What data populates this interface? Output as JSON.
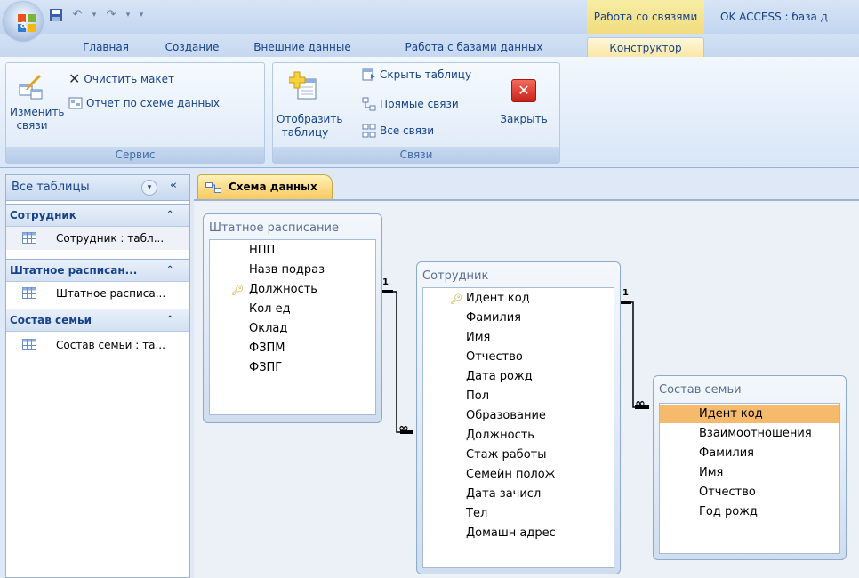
{
  "titlebar": {
    "context_tab": "Работа со связями",
    "app_title": "OK ACCESS : база д"
  },
  "tabs": [
    "Главная",
    "Создание",
    "Внешние данные",
    "Работа с базами данных",
    "Конструктор"
  ],
  "ribbon": {
    "service": {
      "title": "Сервис",
      "edit_relations": "Изменить связи",
      "clear_layout": "Очистить макет",
      "schema_report": "Отчет по схеме данных"
    },
    "relations": {
      "title": "Связи",
      "show_table": "Отобразить таблицу",
      "hide_table": "Скрыть таблицу",
      "direct_relations": "Прямые связи",
      "all_relations": "Все связи",
      "close": "Закрыть"
    }
  },
  "nav": {
    "header": "Все таблицы",
    "groups": [
      {
        "title": "Сотрудник",
        "item": "Сотрудник : табл..."
      },
      {
        "title": "Штатное расписан...",
        "item": "Штатное расписа..."
      },
      {
        "title": "Состав семьи",
        "item": "Состав семьи : та..."
      }
    ]
  },
  "document_tab": "Схема данных",
  "tables": {
    "staff": {
      "title": "Штатное расписание",
      "fields": [
        "НПП",
        "Назв подраз",
        "Должность",
        "Кол ед",
        "Оклад",
        "ФЗПМ",
        "ФЗПГ"
      ],
      "key_field": "Должность"
    },
    "employee": {
      "title": "Сотрудник",
      "fields": [
        "Идент код",
        "Фамилия",
        "Имя",
        "Отчество",
        "Дата рожд",
        "Пол",
        "Образование",
        "Должность",
        "Стаж работы",
        "Семейн полож",
        "Дата зачисл",
        "Тел",
        "Домашн адрес"
      ],
      "key_field": "Идент код"
    },
    "family": {
      "title": "Состав семьи",
      "fields": [
        "Идент код",
        "Взаимоотношения",
        "Фамилия",
        "Имя",
        "Отчество",
        "Год рожд"
      ],
      "selected_field": "Идент код"
    }
  },
  "relations": {
    "one_label": "1",
    "many_label": "∞"
  },
  "colors": {
    "ribbon_bg": "#dde9f8",
    "context_tab": "#f1dc7e",
    "selection": "#f6ba6d",
    "text": "#15428b"
  }
}
